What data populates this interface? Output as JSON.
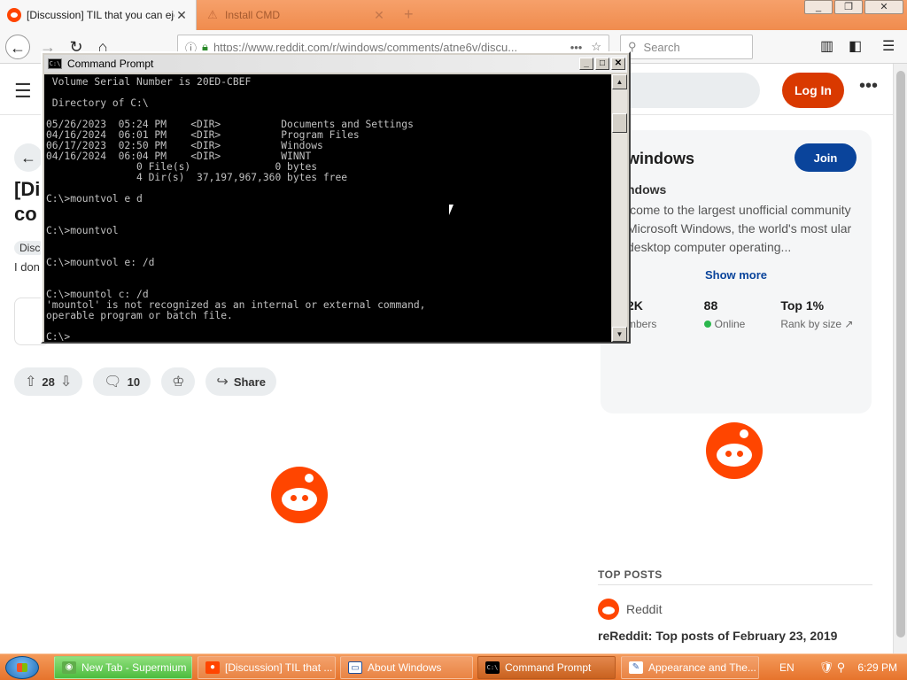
{
  "browser": {
    "tabs": [
      {
        "title": "[Discussion] TIL that you can eject",
        "active": true
      },
      {
        "title": "Install CMD",
        "active": false
      }
    ],
    "window_controls": [
      "_",
      "❐",
      "✕"
    ],
    "url": "https://www.reddit.com/r/windows/comments/atne6v/discu...",
    "search_placeholder": "Search"
  },
  "reddit": {
    "login_label": "Log In",
    "post": {
      "title": "[Di co",
      "flair": "Disc",
      "body": "I don",
      "upvotes": "28",
      "comments": "10",
      "share_label": "Share"
    },
    "sidebar": {
      "name": "windows",
      "join_label": "Join",
      "subtitle": "ndows",
      "description": "lcome to the largest unofficial community Microsoft Windows, the world's most ular desktop computer operating...",
      "show_more": "Show more",
      "stats": [
        {
          "value": "2K",
          "label": "mbers"
        },
        {
          "value": "88",
          "label": "Online"
        },
        {
          "value": "Top 1%",
          "label": "Rank by size"
        }
      ]
    },
    "top_posts": {
      "heading": "TOP POSTS",
      "source": "Reddit",
      "title": "reReddit: Top posts of February 23, 2019"
    }
  },
  "cmd": {
    "title": "Command Prompt",
    "icon_text": "C:\\",
    "output": " Volume Serial Number is 20ED-CBEF\n\n Directory of C:\\\n\n05/26/2023  05:24 PM    <DIR>          Documents and Settings\n04/16/2024  06:01 PM    <DIR>          Program Files\n06/17/2023  02:50 PM    <DIR>          Windows\n04/16/2024  06:04 PM    <DIR>          WINNT\n               0 File(s)              0 bytes\n               4 Dir(s)  37,197,967,360 bytes free\n\nC:\\>mountvol e d\n\n\nC:\\>mountvol\n\n\nC:\\>mountvol e: /d\n\n\nC:\\>mountol c: /d\n'mountol' is not recognized as an internal or external command,\noperable program or batch file.\n\nC:\\>"
  },
  "taskbar": {
    "items": [
      {
        "label": "New Tab - Supermium"
      },
      {
        "label": "[Discussion] TIL that ..."
      },
      {
        "label": "About Windows"
      },
      {
        "label": "Command Prompt"
      },
      {
        "label": "Appearance and The..."
      }
    ],
    "language": "EN",
    "clock": "6:29 PM"
  }
}
